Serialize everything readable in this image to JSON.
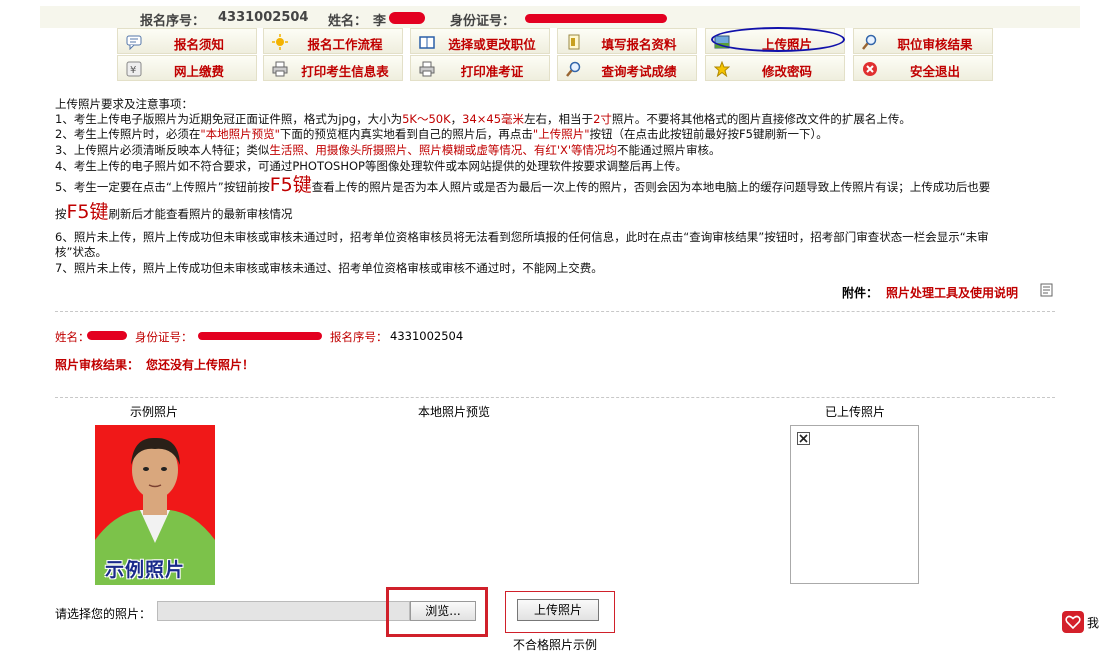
{
  "header": {
    "reg_no_label": "报名序号：",
    "reg_no_value": "4331002504",
    "name_label": "姓名：",
    "name_value": "李",
    "id_label": "身份证号："
  },
  "nav": {
    "row1": [
      "报名须知",
      "报名工作流程",
      "选择或更改职位",
      "填写报名资料",
      "上传照片",
      "职位审核结果"
    ],
    "row2": [
      "网上缴费",
      "打印考生信息表",
      "打印准考证",
      "查询考试成绩",
      "修改密码",
      "安全退出"
    ]
  },
  "notes": {
    "title": "上传照片要求及注意事项：",
    "n1_a": "1、考生上传电子版照片为近期免冠正面证件照，格式为jpg，大小为",
    "n1_size": "5K～50K",
    "n1_sep": "，",
    "n1_dim": "34×45毫米",
    "n1_b": "左右，相当于",
    "n1_inch": "2寸",
    "n1_c": "照片。不要将其他格式的图片直接修改文件的扩展名上传。",
    "n2_a": "2、考生上传照片时，必须在",
    "n2_red1": "\"本地照片预览\"",
    "n2_b": "下面的预览框内真实地看到自己的照片后，再点击",
    "n2_red2": "\"上传照片\"",
    "n2_c": "按钮（在点击此按钮前最好按F5键刷新一下）。",
    "n3_a": "3、上传照片必须清晰反映本人特征；类似",
    "n3_red": "生活照、用摄像头所摄照片、照片模糊或虚等情况、有红'X'等情况均",
    "n3_b": "不能通过照片审核。",
    "n4": "4、考生上传的电子照片如不符合要求，可通过PHOTOSHOP等图像处理软件或本网站提供的处理软件按要求调整后再上传。",
    "n5_a": "5、考生一定要在点击“上传照片”按钮前按",
    "f5": "F5键",
    "n5_b": "查看上传的照片是否为本人照片或是否为最后一次上传的照片，否则会因为本地电脑上的缓存问题导致上传照片有误；上传成功后也要",
    "n5_c": "按",
    "n5_d": "刷新后才能查看照片的最新审核情况",
    "n6_a": "6、照片未上传，照片上传成功但未审核或审核未通过时，招考单位资格审核员将无法看到您所填报的任何信息，此时在点击“查询审核结果”按钮时，招考部门审查状态一栏会显示“未审",
    "n6_b": "核”状态。",
    "n7": "7、照片未上传，照片上传成功但未审核或审核未通过、招考单位资格审核或审核不通过时，不能网上交费。",
    "attach_label": "附件：",
    "attach_link": "照片处理工具及使用说明"
  },
  "info": {
    "name_label": "姓名：",
    "id_label": "身份证号：",
    "reg_label": "报名序号：",
    "reg_value": "4331002504",
    "result_label": "照片审核结果：",
    "result_value": "您还没有上传照片！"
  },
  "photos": {
    "sample_title": "示例照片",
    "sample_caption": "示例照片",
    "preview_title": "本地照片预览",
    "uploaded_title": "已上传照片"
  },
  "form": {
    "choose_label": "请选择您的照片：",
    "browse": "浏览...",
    "upload": "上传照片",
    "bad_example": "不合格照片示例"
  },
  "widget": {
    "label": "我"
  },
  "colors": {
    "accent_red": "#c00000",
    "nav_highlight": "#1111aa",
    "annotation_red": "#d0202a"
  }
}
